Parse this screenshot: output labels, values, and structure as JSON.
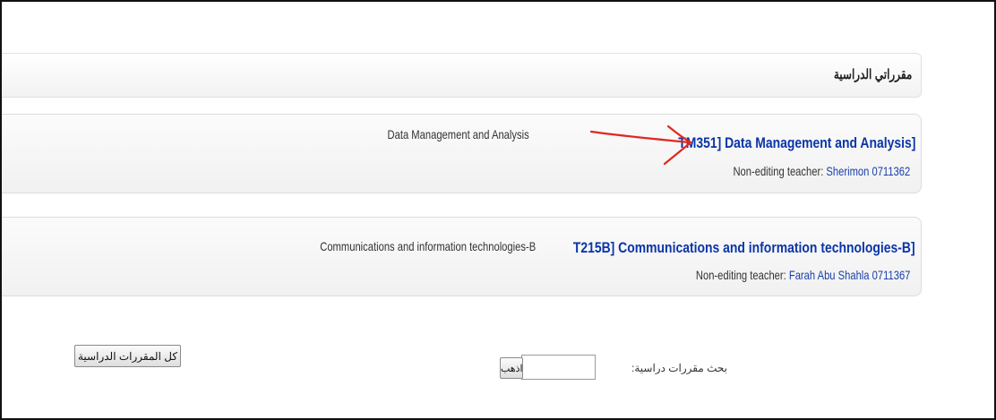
{
  "block": {
    "title": "مقرراتي الدراسية"
  },
  "courses": [
    {
      "title": "TM351] Data Management and Analysis]",
      "teacher_label": "Non-editing teacher: ",
      "teacher_name": "Sherimon 0711362",
      "summary": "Data Management and Analysis"
    },
    {
      "title": "T215B] Communications and information technologies-B]",
      "teacher_label": "Non-editing teacher: ",
      "teacher_name": "Farah Abu Shahla 0711367",
      "summary": "Communications and information technologies-B"
    }
  ],
  "annotation": {
    "arrow_color": "#e0281e"
  },
  "footer": {
    "all_courses_label": "كل المقررات الدراسية",
    "search_label": "بحث مقررات دراسية:",
    "search_value": "",
    "go_label": "اذهب"
  },
  "colors": {
    "link": "#0b35a8",
    "teacher_link": "#1a3fa8"
  }
}
